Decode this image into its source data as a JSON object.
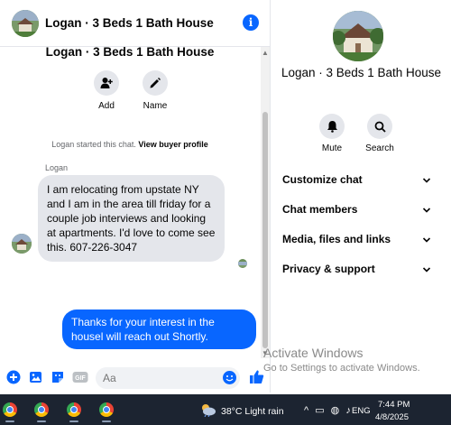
{
  "chat": {
    "title": "Logan · 3 Beds 1 Bath House",
    "top_name": "Logan · 3 Beds 1 Bath House",
    "add_label": "Add",
    "name_label": "Name",
    "started_text": "Logan started this chat.",
    "view_profile": "View buyer profile",
    "sender": "Logan",
    "incoming_message": "I am relocating from upstate NY and I am in the area till friday for a couple job interviews and looking at apartments. I'd love to come see this. 607-226-3047",
    "outgoing_message": "Thanks for your interest in the housel will reach out Shortly.",
    "input_placeholder": "Aa"
  },
  "details": {
    "name": "Logan · 3 Beds 1 Bath House",
    "mute_label": "Mute",
    "search_label": "Search",
    "sections": [
      {
        "label": "Customize chat"
      },
      {
        "label": "Chat members"
      },
      {
        "label": "Media, files and links"
      },
      {
        "label": "Privacy & support"
      }
    ]
  },
  "watermark": {
    "line1": "Activate Windows",
    "line2": "Go to Settings to activate Windows."
  },
  "taskbar": {
    "weather": "38°C  Light rain",
    "language": "ENG",
    "time": "7:44 PM",
    "date": "4/8/2025"
  },
  "colors": {
    "accent": "#0866ff",
    "bubble_incoming": "#e4e6eb",
    "taskbar": "#1c2431"
  }
}
